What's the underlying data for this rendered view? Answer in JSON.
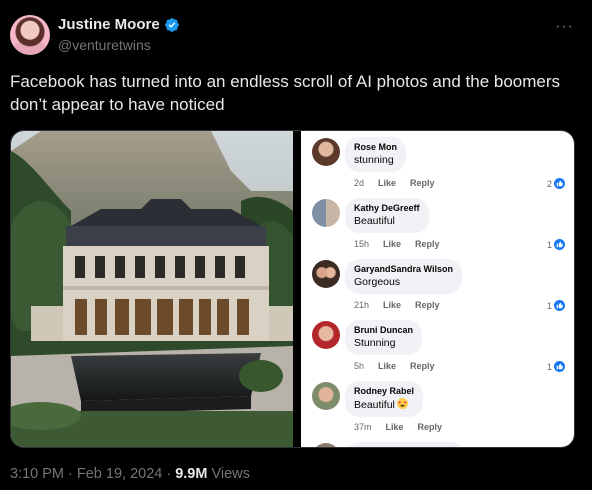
{
  "author": {
    "name": "Justine Moore",
    "handle": "@venturetwins"
  },
  "tweet": {
    "text": "Facebook has turned into an endless scroll of AI photos and the boomers don’t appear to have noticed"
  },
  "comments": [
    {
      "name": "Rose Mon",
      "text": "stunning",
      "time": "2d",
      "like": "Like",
      "reply": "Reply",
      "reactions": "2"
    },
    {
      "name": "Kathy DeGreeff",
      "text": "Beautiful",
      "time": "15h",
      "like": "Like",
      "reply": "Reply",
      "reactions": "1"
    },
    {
      "name": "GaryandSandra Wilson",
      "text": "Gorgeous",
      "time": "21h",
      "like": "Like",
      "reply": "Reply",
      "reactions": "1"
    },
    {
      "name": "Bruni Duncan",
      "text": "Stunning",
      "time": "5h",
      "like": "Like",
      "reply": "Reply",
      "reactions": "1"
    },
    {
      "name": "Rodney Rabel",
      "text": "Beautiful",
      "time": "37m",
      "like": "Like",
      "reply": "Reply",
      "reactions": ""
    }
  ],
  "footer": {
    "datetime": "3:10 PM · Feb 19, 2024 ·",
    "views_count": "9.9M",
    "views_label": "Views"
  },
  "colors": {
    "background": "#000000",
    "verified": "#1d9bf0",
    "facebook_like": "#1877f2"
  },
  "icons": {
    "verified": "verified-badge-icon",
    "more": "more-icon",
    "like": "like-thumb-icon",
    "heart_eyes": "heart-eyes-emoji-icon"
  }
}
